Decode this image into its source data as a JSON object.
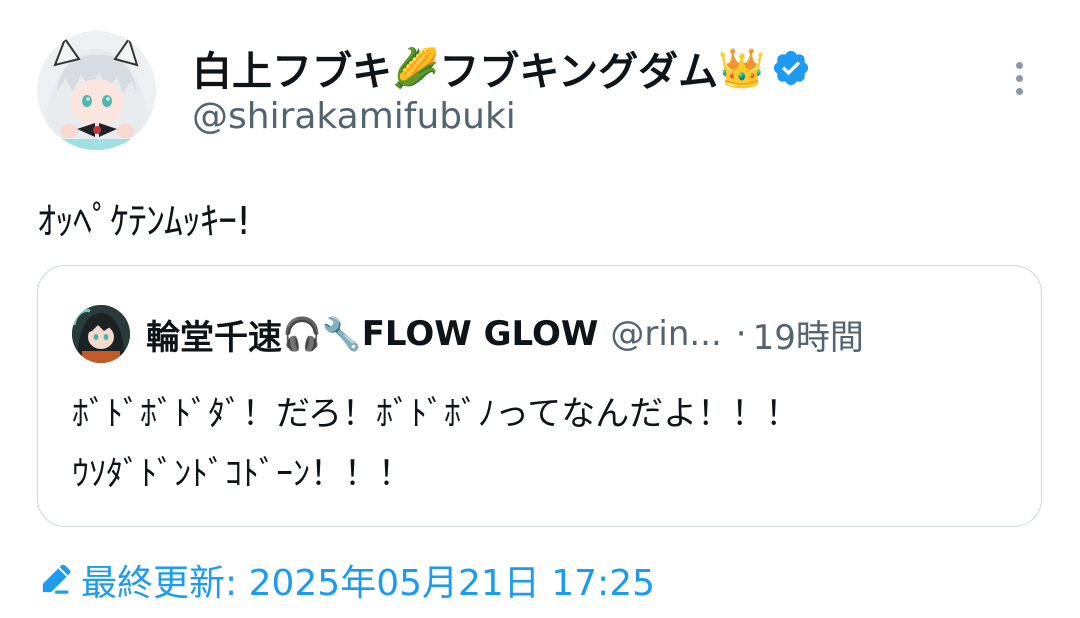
{
  "author": {
    "display_name": "白上フブキ",
    "emoji_1": "🌽",
    "display_name_suffix": "フブキングダム",
    "emoji_2": "👑",
    "handle": "@shirakamifubuki",
    "verified": true
  },
  "tweet": {
    "text": "ｵｯﾍﾟｹﾃﾝﾑｯｷｰ!"
  },
  "quote": {
    "display_name": "輪堂千速",
    "emoji_1": "🎧",
    "emoji_2": "🔧",
    "display_name_suffix": "FLOW GLOW",
    "handle": "@rin...",
    "separator": "·",
    "time": "19時間",
    "text_line_1": "ﾎﾞﾄﾞﾎﾞﾄﾞﾀﾞ！だろ！ﾎﾞﾄﾞﾎﾞﾉってなんだよ！！！",
    "text_line_2": "ｳｿﾀﾞﾄﾞﾝﾄﾞｺﾄﾞｰﾝ！！！"
  },
  "footer": {
    "updated_label": "最終更新: 2025年05月21日 17:25"
  },
  "colors": {
    "accent": "#1d9bf0",
    "secondary_text": "#536471",
    "border": "#cfd9de"
  },
  "icons": {
    "more": "more-vertical-icon",
    "verified": "verified-badge-icon",
    "edited": "pencil-icon"
  }
}
